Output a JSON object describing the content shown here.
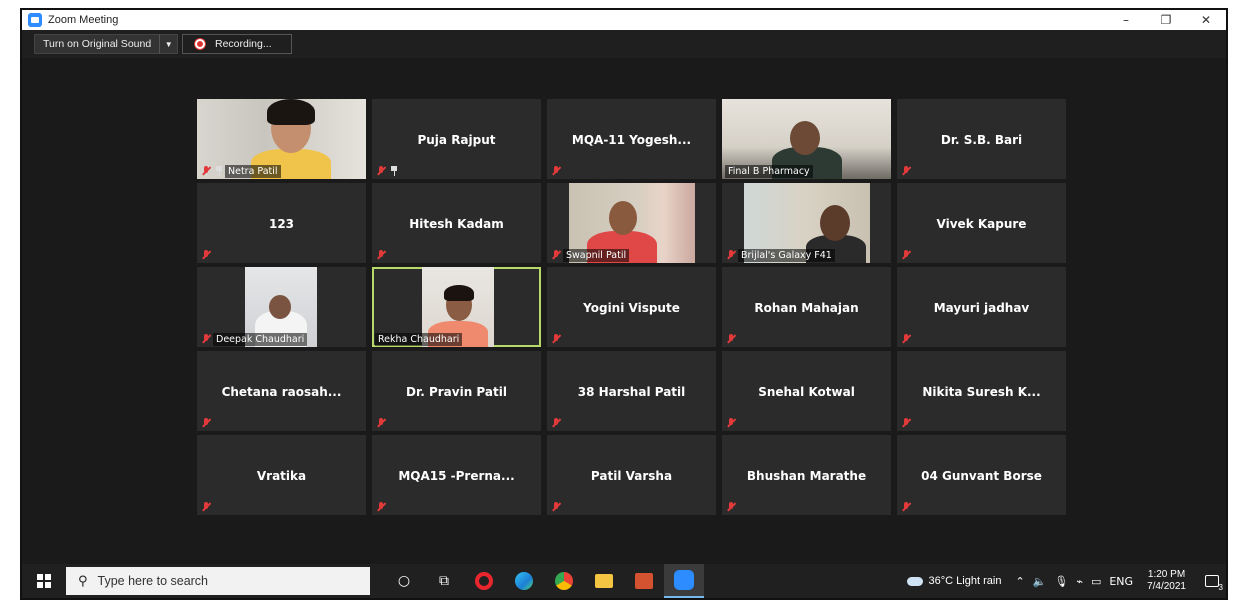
{
  "window": {
    "title": "Zoom Meeting",
    "controls": {
      "minimize": "–",
      "restore": "❐",
      "close": "✕"
    }
  },
  "toolbar": {
    "original_sound_label": "Turn on Original Sound",
    "recording_label": "Recording..."
  },
  "participants": [
    {
      "name": "Netra Patil",
      "video": true,
      "muted": true,
      "pinned": true
    },
    {
      "name": "Puja Rajput",
      "video": false,
      "muted": true,
      "pinned": true
    },
    {
      "name": "MQA-11  Yogesh...",
      "video": false,
      "muted": true
    },
    {
      "name": "Final B Pharmacy",
      "video": true,
      "muted": false
    },
    {
      "name": "Dr. S.B. Bari",
      "video": false,
      "muted": true
    },
    {
      "name": "123",
      "video": false,
      "muted": true
    },
    {
      "name": "Hitesh Kadam",
      "video": false,
      "muted": true
    },
    {
      "name": "Swapnil Patil",
      "video": true,
      "muted": true
    },
    {
      "name": "Brijlal's Galaxy F41",
      "video": true,
      "muted": true
    },
    {
      "name": "Vivek Kapure",
      "video": false,
      "muted": true
    },
    {
      "name": "Deepak Chaudhari",
      "video": true,
      "muted": true
    },
    {
      "name": "Rekha Chaudhari",
      "video": true,
      "muted": false,
      "active_speaker": true
    },
    {
      "name": "Yogini Vispute",
      "video": false,
      "muted": true
    },
    {
      "name": "Rohan Mahajan",
      "video": false,
      "muted": true
    },
    {
      "name": "Mayuri jadhav",
      "video": false,
      "muted": true
    },
    {
      "name": "Chetana  raosah...",
      "video": false,
      "muted": true
    },
    {
      "name": "Dr. Pravin Patil",
      "video": false,
      "muted": true
    },
    {
      "name": "38 Harshal Patil",
      "video": false,
      "muted": true
    },
    {
      "name": "Snehal Kotwal",
      "video": false,
      "muted": true
    },
    {
      "name": "Nikita Suresh  K...",
      "video": false,
      "muted": true
    },
    {
      "name": "Vratika",
      "video": false,
      "muted": true
    },
    {
      "name": "MQA15  -Prerna...",
      "video": false,
      "muted": true
    },
    {
      "name": "Patil Varsha",
      "video": false,
      "muted": true
    },
    {
      "name": "Bhushan Marathe",
      "video": false,
      "muted": true
    },
    {
      "name": "04 Gunvant Borse",
      "video": false,
      "muted": true
    }
  ],
  "taskbar": {
    "search_placeholder": "Type here to search",
    "weather": "36°C  Light rain",
    "language": "ENG",
    "time": "1:20 PM",
    "date": "7/4/2021",
    "notification_count": "3",
    "icons": [
      "task-view-icon",
      "opera-icon",
      "edge-icon",
      "chrome-icon",
      "file-explorer-icon",
      "powerpoint-icon",
      "zoom-icon"
    ]
  },
  "colors": {
    "active_speaker_border": "#b8d96a",
    "mute_icon": "#e23a3a",
    "tile_bg": "#2b2b2b",
    "zoom_blue": "#2d8cff"
  }
}
